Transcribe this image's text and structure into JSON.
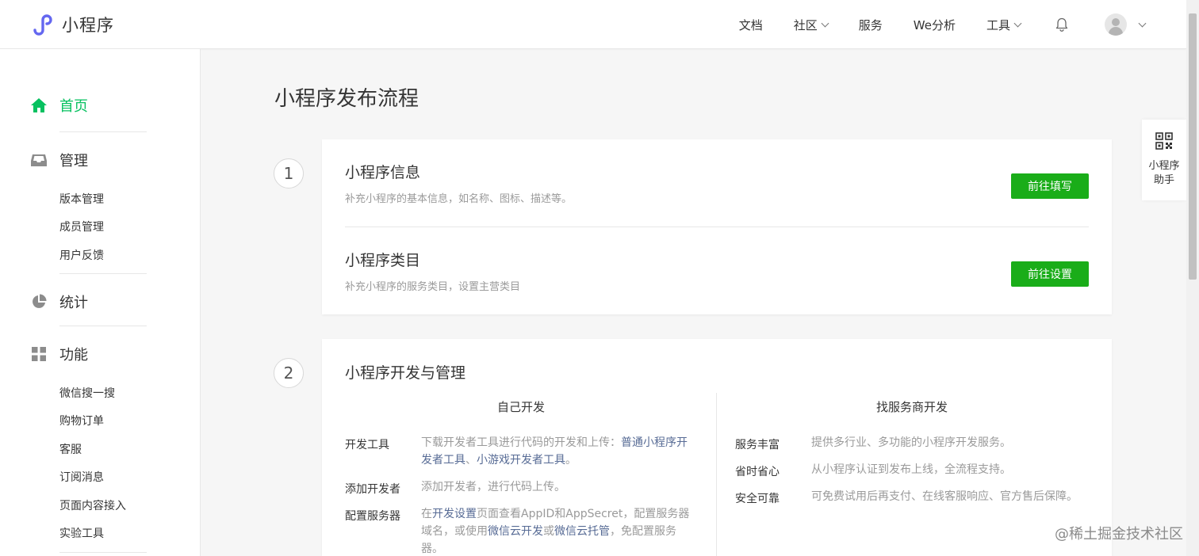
{
  "header": {
    "logo_text": "小程序",
    "nav": [
      {
        "label": "文档",
        "dropdown": false
      },
      {
        "label": "社区",
        "dropdown": true
      },
      {
        "label": "服务",
        "dropdown": false
      },
      {
        "label": "We分析",
        "dropdown": false
      },
      {
        "label": "工具",
        "dropdown": true
      }
    ]
  },
  "sidebar": {
    "home": "首页",
    "manage": "管理",
    "manage_items": [
      "版本管理",
      "成员管理",
      "用户反馈"
    ],
    "stats": "统计",
    "features": "功能",
    "feature_items": [
      "微信搜一搜",
      "购物订单",
      "客服",
      "订阅消息",
      "页面内容接入",
      "实验工具"
    ]
  },
  "main": {
    "title": "小程序发布流程",
    "step1": {
      "number": "1",
      "info_title": "小程序信息",
      "info_desc": "补充小程序的基本信息，如名称、图标、描述等。",
      "info_button": "前往填写",
      "category_title": "小程序类目",
      "category_desc": "补充小程序的服务类目，设置主营类目",
      "category_button": "前往设置"
    },
    "step2": {
      "number": "2",
      "title": "小程序开发与管理",
      "self_dev": {
        "heading": "自己开发",
        "tools_label": "开发工具",
        "tools_desc_1": "下载开发者工具进行代码的开发和上传：",
        "tools_link_1": "普通小程序开发者工具",
        "tools_sep": "、",
        "tools_link_2": "小游戏开发者工具",
        "tools_end": "。",
        "add_dev_label": "添加开发者",
        "add_dev_desc": "添加开发者，进行代码上传。",
        "server_label": "配置服务器",
        "server_desc_1": "在",
        "server_link_1": "开发设置",
        "server_desc_2": "页面查看AppID和AppSecret，配置服务器域名，或使用",
        "server_link_2": "微信云开发",
        "server_desc_3": "或",
        "server_link_3": "微信云托管",
        "server_desc_4": "，免配置服务器。"
      },
      "provider_dev": {
        "heading": "找服务商开发",
        "rows": [
          {
            "label": "服务丰富",
            "desc": "提供多行业、多功能的小程序开发服务。"
          },
          {
            "label": "省时省心",
            "desc": "从小程序认证到发布上线，全流程支持。"
          },
          {
            "label": "安全可靠",
            "desc": "可免费试用后再支付、在线客服响应、官方售后保障。"
          }
        ]
      }
    }
  },
  "assistant": {
    "label": "小程序助手"
  },
  "watermark": "@稀土掘金技术社区",
  "colors": {
    "accent": "#07c160",
    "button": "#1aad19",
    "link": "#576b95"
  }
}
